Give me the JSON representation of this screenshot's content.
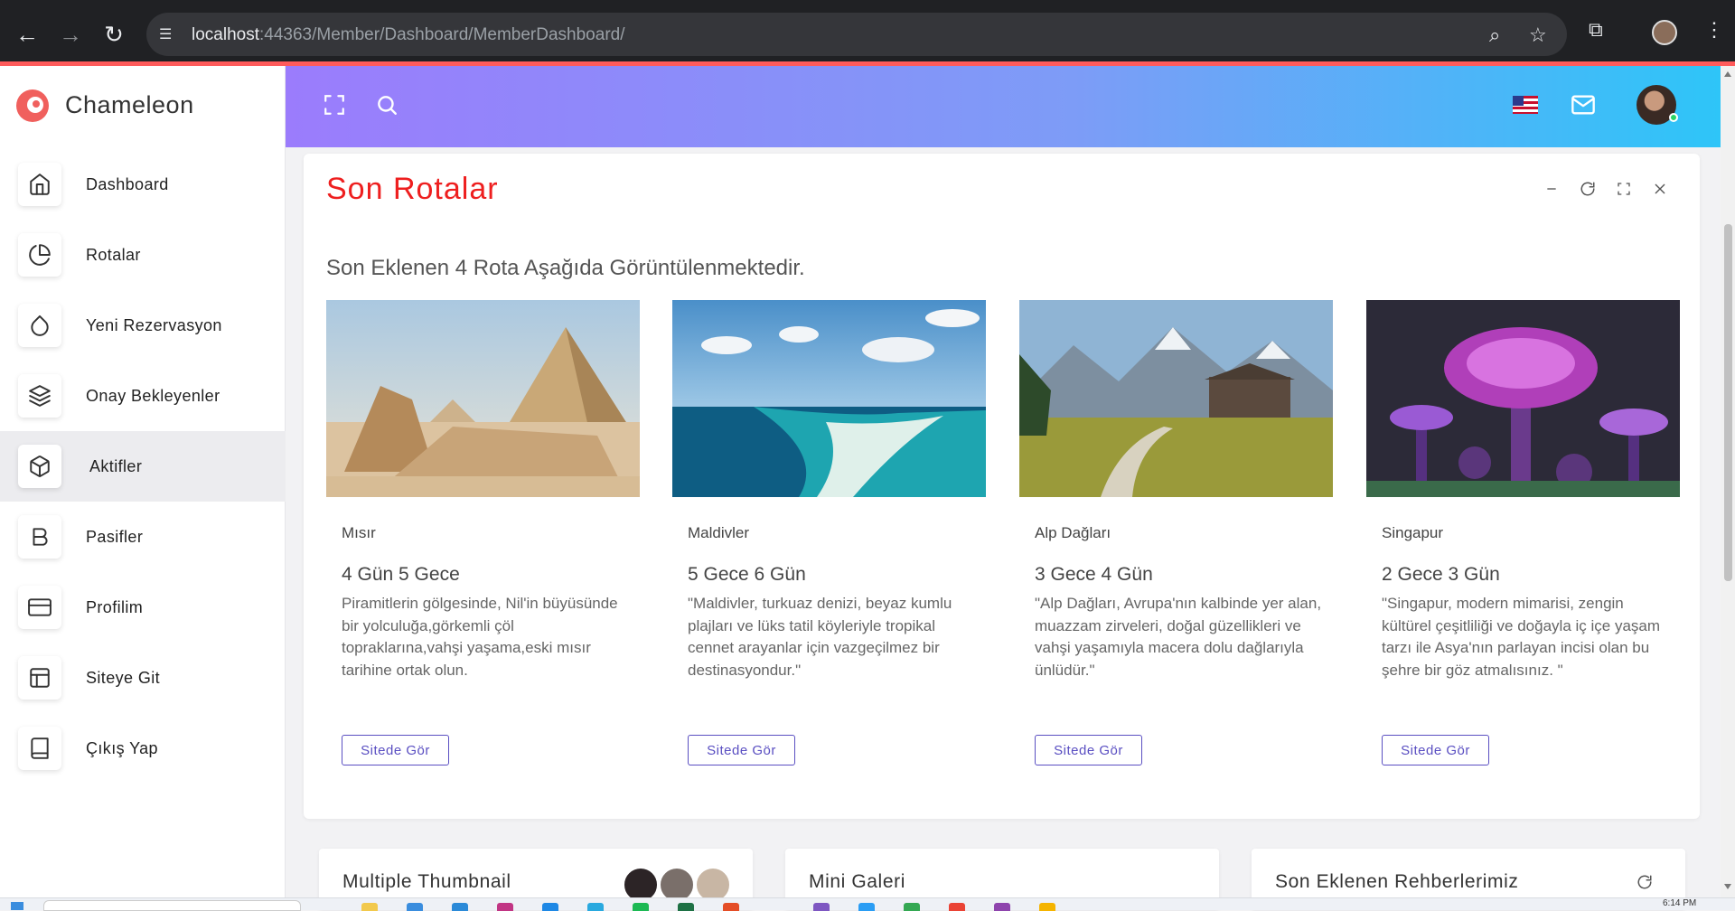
{
  "browser": {
    "url_host": "localhost",
    "url_path": ":44363/Member/Dashboard/MemberDashboard/"
  },
  "sidebar": {
    "brand": "Chameleon",
    "items": [
      {
        "label": "Dashboard",
        "icon": "home-icon"
      },
      {
        "label": "Rotalar",
        "icon": "pie-chart-icon"
      },
      {
        "label": "Yeni Rezervasyon",
        "icon": "droplet-icon"
      },
      {
        "label": "Onay Bekleyenler",
        "icon": "layers-icon"
      },
      {
        "label": "Aktifler",
        "icon": "box-icon",
        "active": true
      },
      {
        "label": "Pasifler",
        "icon": "bold-icon"
      },
      {
        "label": "Profilim",
        "icon": "credit-card-icon"
      },
      {
        "label": "Siteye Git",
        "icon": "layout-icon"
      },
      {
        "label": "Çıkış Yap",
        "icon": "book-icon"
      }
    ]
  },
  "header": {
    "left_icons": [
      "fullscreen-icon",
      "search-icon"
    ],
    "right_icons": [
      "us-flag-icon",
      "mail-icon",
      "user-avatar"
    ]
  },
  "main": {
    "title": "Son Rotalar",
    "tools": [
      "minimize-icon",
      "refresh-icon",
      "expand-icon",
      "close-icon"
    ],
    "subtitle": "Son Eklenen 4 Rota Aşağıda Görüntülenmektedir.",
    "routes": [
      {
        "name": "Mısır",
        "duration": "4 Gün 5 Gece",
        "description": "Piramitlerin gölgesinde, Nil'in büyüsünde bir yolculuğa,görkemli çöl topraklarına,vahşi yaşama,eski mısır tarihine ortak olun.",
        "button": "Sitede Gör"
      },
      {
        "name": "Maldivler",
        "duration": "5 Gece 6 Gün",
        "description": "\"Maldivler, turkuaz denizi, beyaz kumlu plajları ve lüks tatil köyleriyle tropikal cennet arayanlar için vazgeçilmez bir destinasyondur.\"",
        "button": "Sitede Gör"
      },
      {
        "name": "Alp Dağları",
        "duration": "3 Gece 4 Gün",
        "description": "\"Alp Dağları, Avrupa'nın kalbinde yer alan, muazzam zirveleri, doğal güzellikleri ve vahşi yaşamıyla macera dolu dağlarıyla ünlüdür.\"",
        "button": "Sitede Gör"
      },
      {
        "name": "Singapur",
        "duration": "2 Gece 3 Gün",
        "description": "\"Singapur, modern mimarisi, zengin kültürel çeşitliliği ve doğayla iç içe yaşam tarzı ile Asya'nın parlayan incisi olan bu şehre bir göz atmalısınız. \"",
        "button": "Sitede Gör"
      }
    ]
  },
  "bottom_cards": [
    {
      "title": "Multiple Thumbnail"
    },
    {
      "title": "Mini Galeri"
    },
    {
      "title": "Son Eklenen Rehberlerimiz"
    }
  ],
  "taskbar": {
    "clock": "6:14 PM"
  },
  "colors": {
    "accent_red": "#ee1f1f",
    "button_purple": "#5a4fc2",
    "header_gradient_start": "#9b7cfc",
    "header_gradient_end": "#2ec5f8"
  }
}
